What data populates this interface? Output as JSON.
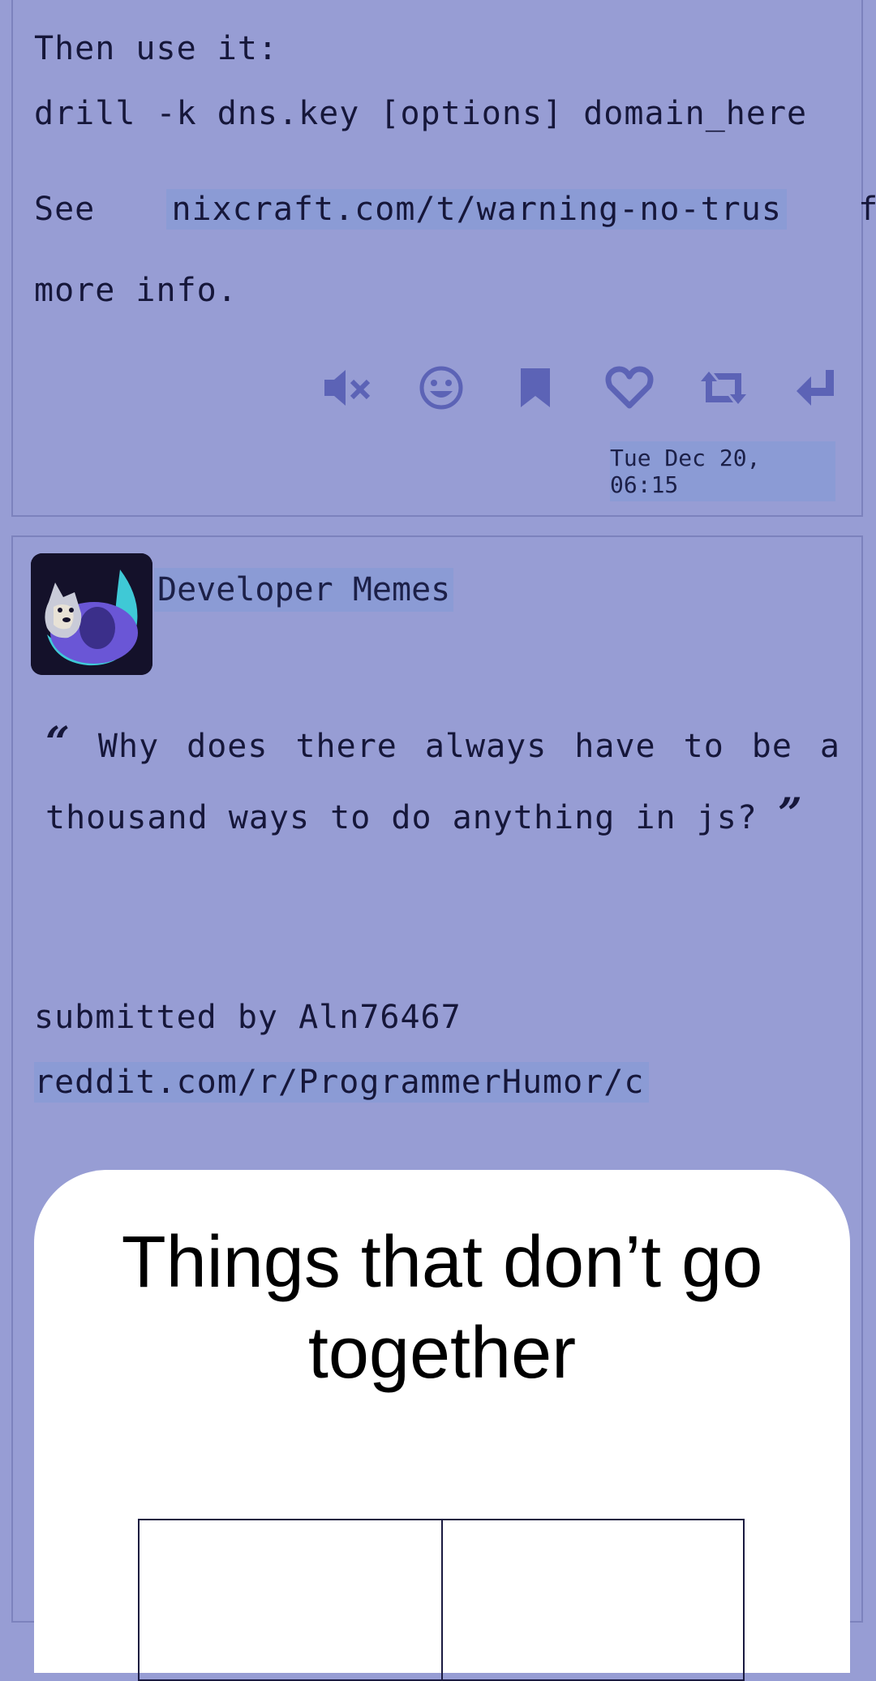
{
  "post1": {
    "text_then": "Then use it:",
    "text_command": "drill -k dns.key [options] domain_here",
    "text_see": "See",
    "link": "nixcraft.com/t/warning-no-trus",
    "text_for": "for",
    "text_more": "more info.",
    "actions": {
      "mute_icon": "mute-icon",
      "emoji_icon": "smiley-icon",
      "bookmark_icon": "bookmark-icon",
      "like_icon": "heart-icon",
      "repost_icon": "repost-icon",
      "reply_icon": "reply-icon"
    },
    "timestamp": "Tue Dec 20, 06:15"
  },
  "post2": {
    "author": "Developer Memes",
    "quote": "Why does there always have to be a thousand ways to do anything in js?",
    "quote_open": "“",
    "quote_close": "”",
    "submitted_by": "submitted by Aln76467",
    "link": "reddit.com/r/ProgrammerHumor/c",
    "meme_title_line1": "Things that don’t go",
    "meme_title_line2": "together"
  },
  "colors": {
    "background": "#979dd4",
    "link_highlight": "#8b9bd5",
    "icon": "#5c63b6",
    "text": "#16173a"
  }
}
